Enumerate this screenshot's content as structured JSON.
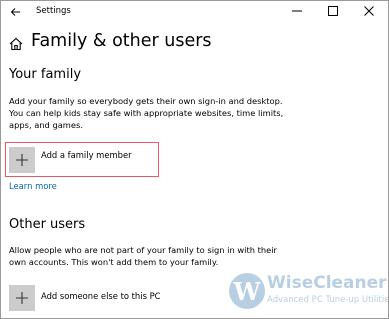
{
  "window": {
    "app_title": "Settings"
  },
  "page": {
    "title": "Family & other users"
  },
  "your_family": {
    "heading": "Your family",
    "description": "Add your family so everybody gets their own sign-in and desktop. You can help kids stay safe with appropriate websites, time limits, apps, and games.",
    "add_button_label": "Add a family member",
    "learn_more": "Learn more"
  },
  "other_users": {
    "heading": "Other users",
    "description": "Allow people who are not part of your family to sign in with their own accounts. This won't add them to your family.",
    "add_button_label": "Add someone else to this PC"
  },
  "watermark": {
    "badge_letter": "W",
    "name": "WiseCleaner",
    "tagline": "Advanced PC Tune-up Utilities"
  },
  "colors": {
    "highlight_border": "#e35b64",
    "link": "#0067b8",
    "plus_tile": "#cccccc",
    "watermark": "#b8cfe3"
  }
}
